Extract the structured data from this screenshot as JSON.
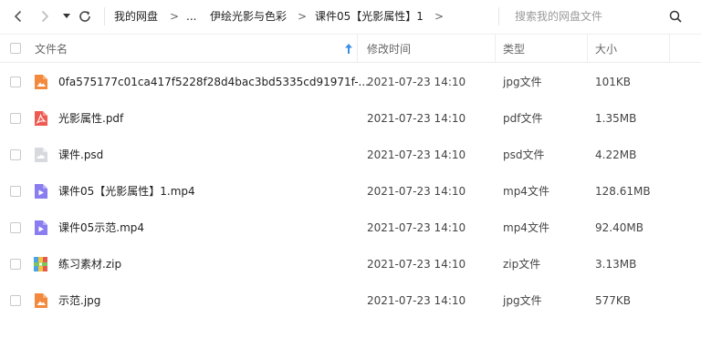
{
  "toolbar": {
    "back_icon": "chevron-left-icon",
    "forward_icon": "chevron-right-icon",
    "history_icon": "caret-down-icon",
    "refresh_icon": "refresh-icon"
  },
  "breadcrumb": {
    "items": [
      "我的网盘",
      "...",
      "伊绘光影与色彩",
      "课件05【光影属性】1"
    ],
    "separator": ">"
  },
  "search": {
    "placeholder": "搜索我的网盘文件",
    "icon": "search-icon"
  },
  "table": {
    "headers": {
      "name": "文件名",
      "modified": "修改时间",
      "type": "类型",
      "size": "大小"
    },
    "sort_icon": "sort-arrow-up-icon",
    "rows": [
      {
        "name": "0fa575177c01ca417f5228f28d4bac3bd5335cd91971f-...",
        "modified": "2021-07-23 14:10",
        "type": "jpg文件",
        "size": "101KB",
        "icon": "image-file-icon"
      },
      {
        "name": "光影属性.pdf",
        "modified": "2021-07-23 14:10",
        "type": "pdf文件",
        "size": "1.35MB",
        "icon": "pdf-file-icon"
      },
      {
        "name": "课件.psd",
        "modified": "2021-07-23 14:10",
        "type": "psd文件",
        "size": "4.22MB",
        "icon": "psd-file-icon"
      },
      {
        "name": "课件05【光影属性】1.mp4",
        "modified": "2021-07-23 14:10",
        "type": "mp4文件",
        "size": "128.61MB",
        "icon": "video-file-icon"
      },
      {
        "name": "课件05示范.mp4",
        "modified": "2021-07-23 14:10",
        "type": "mp4文件",
        "size": "92.40MB",
        "icon": "video-file-icon"
      },
      {
        "name": "练习素材.zip",
        "modified": "2021-07-23 14:10",
        "type": "zip文件",
        "size": "3.13MB",
        "icon": "zip-file-icon"
      },
      {
        "name": "示范.jpg",
        "modified": "2021-07-23 14:10",
        "type": "jpg文件",
        "size": "577KB",
        "icon": "image-file-icon"
      }
    ]
  },
  "colors": {
    "image_icon": "#f3893c",
    "pdf_icon": "#ee5a52",
    "psd_icon": "#d6d9de",
    "video_icon": "#8a7df0",
    "sort_arrow": "#3a8ee6"
  }
}
